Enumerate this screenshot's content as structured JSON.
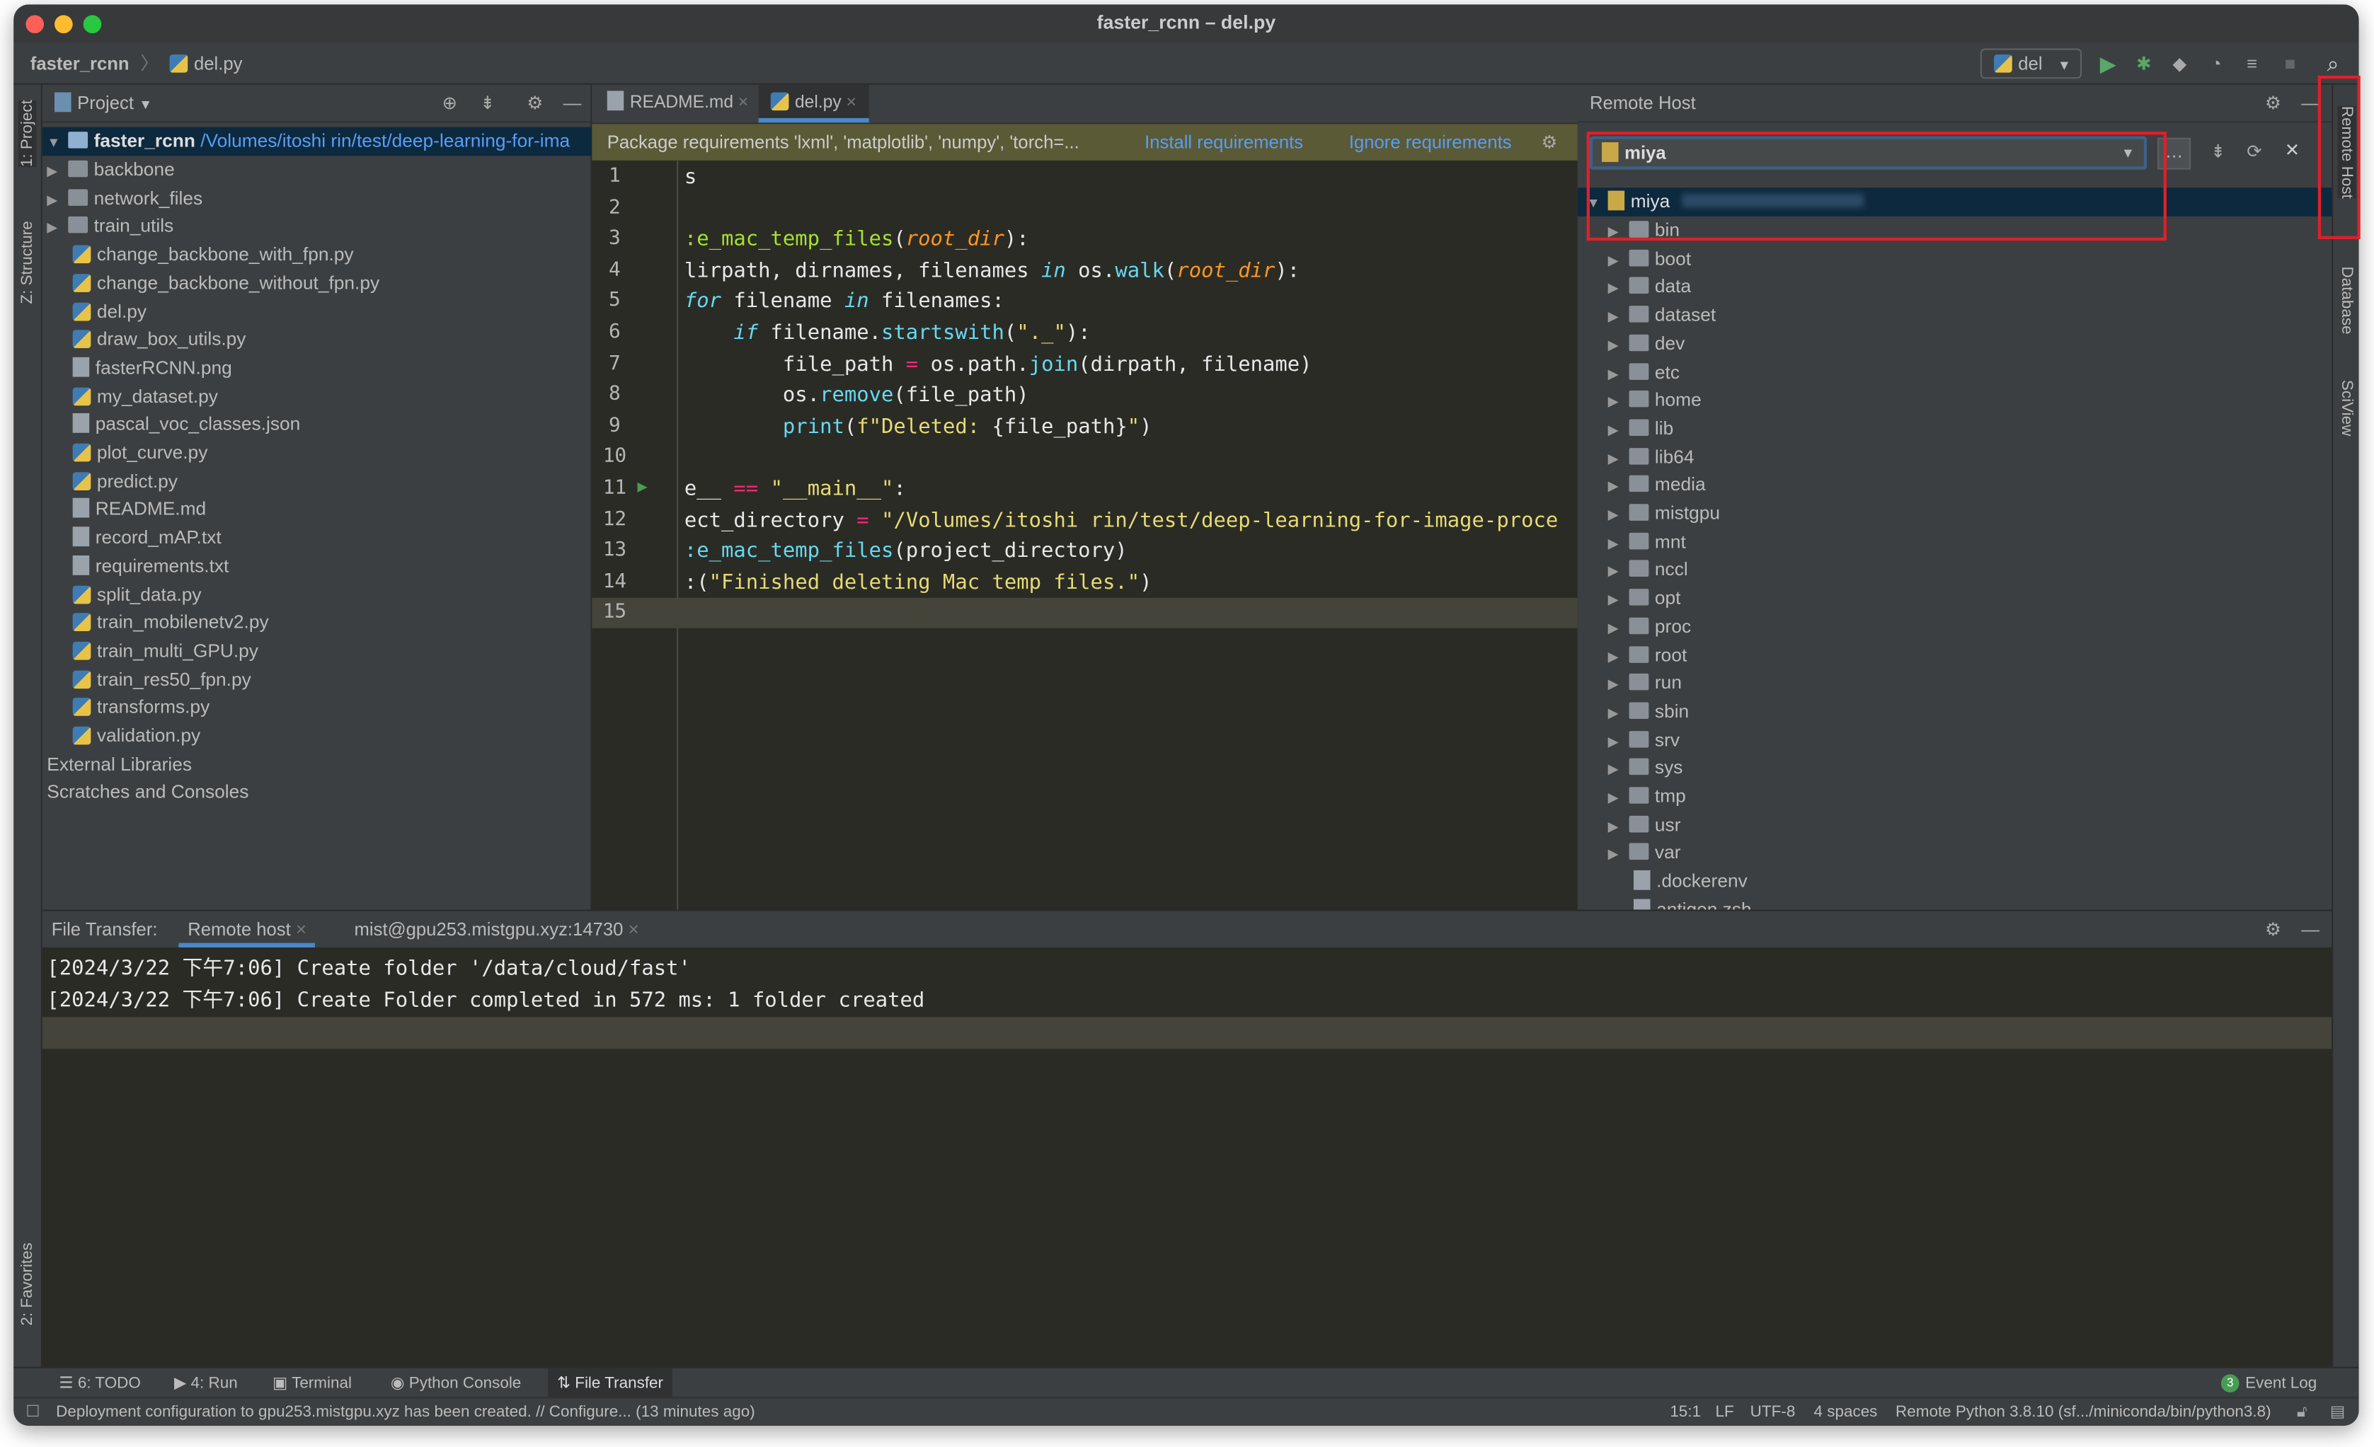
{
  "window": {
    "title": "faster_rcnn – del.py"
  },
  "navbar": {
    "crumbs": [
      "faster_rcnn",
      "del.py"
    ],
    "run_config": "del"
  },
  "left_strip": {
    "project": "1: Project",
    "structure": "Z: Structure",
    "favorites": "2: Favorites"
  },
  "right_strip": {
    "remote_host": "Remote Host",
    "database": "Database",
    "sciview": "SciView"
  },
  "project": {
    "header": "Project",
    "root_name": "faster_rcnn",
    "root_path": "/Volumes/itoshi rin/test/deep-learning-for-ima",
    "items": [
      {
        "name": "backbone",
        "type": "folder"
      },
      {
        "name": "network_files",
        "type": "folder"
      },
      {
        "name": "train_utils",
        "type": "folder"
      },
      {
        "name": "change_backbone_with_fpn.py",
        "type": "py"
      },
      {
        "name": "change_backbone_without_fpn.py",
        "type": "py"
      },
      {
        "name": "del.py",
        "type": "py"
      },
      {
        "name": "draw_box_utils.py",
        "type": "py"
      },
      {
        "name": "fasterRCNN.png",
        "type": "file"
      },
      {
        "name": "my_dataset.py",
        "type": "py"
      },
      {
        "name": "pascal_voc_classes.json",
        "type": "file"
      },
      {
        "name": "plot_curve.py",
        "type": "py"
      },
      {
        "name": "predict.py",
        "type": "py"
      },
      {
        "name": "README.md",
        "type": "file"
      },
      {
        "name": "record_mAP.txt",
        "type": "file"
      },
      {
        "name": "requirements.txt",
        "type": "file"
      },
      {
        "name": "split_data.py",
        "type": "py"
      },
      {
        "name": "train_mobilenetv2.py",
        "type": "py"
      },
      {
        "name": "train_multi_GPU.py",
        "type": "py"
      },
      {
        "name": "train_res50_fpn.py",
        "type": "py"
      },
      {
        "name": "transforms.py",
        "type": "py"
      },
      {
        "name": "validation.py",
        "type": "py"
      }
    ],
    "external": "External Libraries",
    "scratches": "Scratches and Consoles"
  },
  "editor": {
    "tabs": [
      {
        "label": "README.md",
        "active": false
      },
      {
        "label": "del.py",
        "active": true
      }
    ],
    "banner": {
      "text": "Package requirements 'lxml', 'matplotlib', 'numpy', 'torch=...",
      "install": "Install requirements",
      "ignore": "Ignore requirements"
    },
    "lines": [
      [
        [
          "",
          "s"
        ]
      ],
      [],
      [
        [
          "fn",
          ":e_mac_temp_files"
        ],
        [
          "",
          "("
        ],
        [
          "pa",
          "root_dir"
        ],
        [
          "",
          "):"
        ]
      ],
      [
        [
          "",
          "lirpath, dirnames, filenames "
        ],
        [
          "kw",
          "in"
        ],
        [
          "",
          " os."
        ],
        [
          "bi",
          "walk"
        ],
        [
          "",
          "("
        ],
        [
          "pa",
          "root_dir"
        ],
        [
          "",
          "):"
        ]
      ],
      [
        [
          "kw",
          "for"
        ],
        [
          "",
          " filename "
        ],
        [
          "kw",
          "in"
        ],
        [
          "",
          " filenames:"
        ]
      ],
      [
        [
          "",
          "    "
        ],
        [
          "kw",
          "if"
        ],
        [
          "",
          " filename."
        ],
        [
          "bi",
          "startswith"
        ],
        [
          "",
          "("
        ],
        [
          "st",
          "\"._\""
        ],
        [
          "",
          "):"
        ]
      ],
      [
        [
          "",
          "        file_path "
        ],
        [
          "op",
          "="
        ],
        [
          "",
          " os.path."
        ],
        [
          "bi",
          "join"
        ],
        [
          "",
          "(dirpath, filename)"
        ]
      ],
      [
        [
          "",
          "        os."
        ],
        [
          "bi",
          "remove"
        ],
        [
          "",
          "(file_path)"
        ]
      ],
      [
        [
          "",
          "        "
        ],
        [
          "bi",
          "print"
        ],
        [
          "",
          "("
        ],
        [
          "st",
          "f\"Deleted: "
        ],
        [
          "",
          "{file_path}"
        ],
        [
          "st",
          "\""
        ],
        [
          "",
          ")"
        ]
      ],
      [],
      [
        [
          "",
          "e__ "
        ],
        [
          "op",
          "=="
        ],
        [
          "",
          " "
        ],
        [
          "st",
          "\"__main__\""
        ],
        [
          "",
          ":"
        ]
      ],
      [
        [
          "",
          "ect_directory "
        ],
        [
          "op",
          "="
        ],
        [
          "",
          " "
        ],
        [
          "st",
          "\"/Volumes/itoshi rin/test/deep-learning-for-image-proce"
        ]
      ],
      [
        [
          "bi",
          ":e_mac_temp_files"
        ],
        [
          "",
          "(project_directory)"
        ]
      ],
      [
        [
          "",
          ":("
        ],
        [
          "st",
          "\"Finished deleting Mac temp files.\""
        ],
        [
          "",
          ")"
        ]
      ],
      []
    ]
  },
  "remote": {
    "header": "Remote Host",
    "server": "miya",
    "root": "miya",
    "items": [
      {
        "name": "bin",
        "type": "folder"
      },
      {
        "name": "boot",
        "type": "folder"
      },
      {
        "name": "data",
        "type": "folder"
      },
      {
        "name": "dataset",
        "type": "folder"
      },
      {
        "name": "dev",
        "type": "folder"
      },
      {
        "name": "etc",
        "type": "folder"
      },
      {
        "name": "home",
        "type": "folder"
      },
      {
        "name": "lib",
        "type": "folder"
      },
      {
        "name": "lib64",
        "type": "folder"
      },
      {
        "name": "media",
        "type": "folder"
      },
      {
        "name": "mistgpu",
        "type": "folder"
      },
      {
        "name": "mnt",
        "type": "folder"
      },
      {
        "name": "nccl",
        "type": "folder"
      },
      {
        "name": "opt",
        "type": "folder"
      },
      {
        "name": "proc",
        "type": "folder"
      },
      {
        "name": "root",
        "type": "folder"
      },
      {
        "name": "run",
        "type": "folder"
      },
      {
        "name": "sbin",
        "type": "folder"
      },
      {
        "name": "srv",
        "type": "folder"
      },
      {
        "name": "sys",
        "type": "folder"
      },
      {
        "name": "tmp",
        "type": "folder"
      },
      {
        "name": "usr",
        "type": "folder"
      },
      {
        "name": "var",
        "type": "folder"
      },
      {
        "name": ".dockerenv",
        "type": "file"
      },
      {
        "name": "antigen.zsh",
        "type": "file"
      }
    ]
  },
  "bottom": {
    "label": "File Transfer:",
    "tabs": [
      "Remote host",
      "mist@gpu253.mistgpu.xyz:14730"
    ],
    "log": [
      "[2024/3/22 下午7:06] Create folder '/data/cloud/fast'",
      "[2024/3/22 下午7:06] Create Folder completed in 572 ms: 1 folder created"
    ]
  },
  "toolbar": {
    "items": [
      "6: TODO",
      "4: Run",
      "Terminal",
      "Python Console",
      "File Transfer"
    ],
    "event_count": "3",
    "event_log": "Event Log"
  },
  "status": {
    "message": "Deployment configuration to gpu253.mistgpu.xyz has been created. // Configure... (13 minutes ago)",
    "position": "15:1",
    "line_sep": "LF",
    "encoding": "UTF-8",
    "indent": "4 spaces",
    "interpreter": "Remote Python 3.8.10 (sf.../miniconda/bin/python3.8)"
  },
  "colors": {
    "accent": "#589df6",
    "highlight": "#e0202a",
    "banner": "#5b5a36"
  }
}
